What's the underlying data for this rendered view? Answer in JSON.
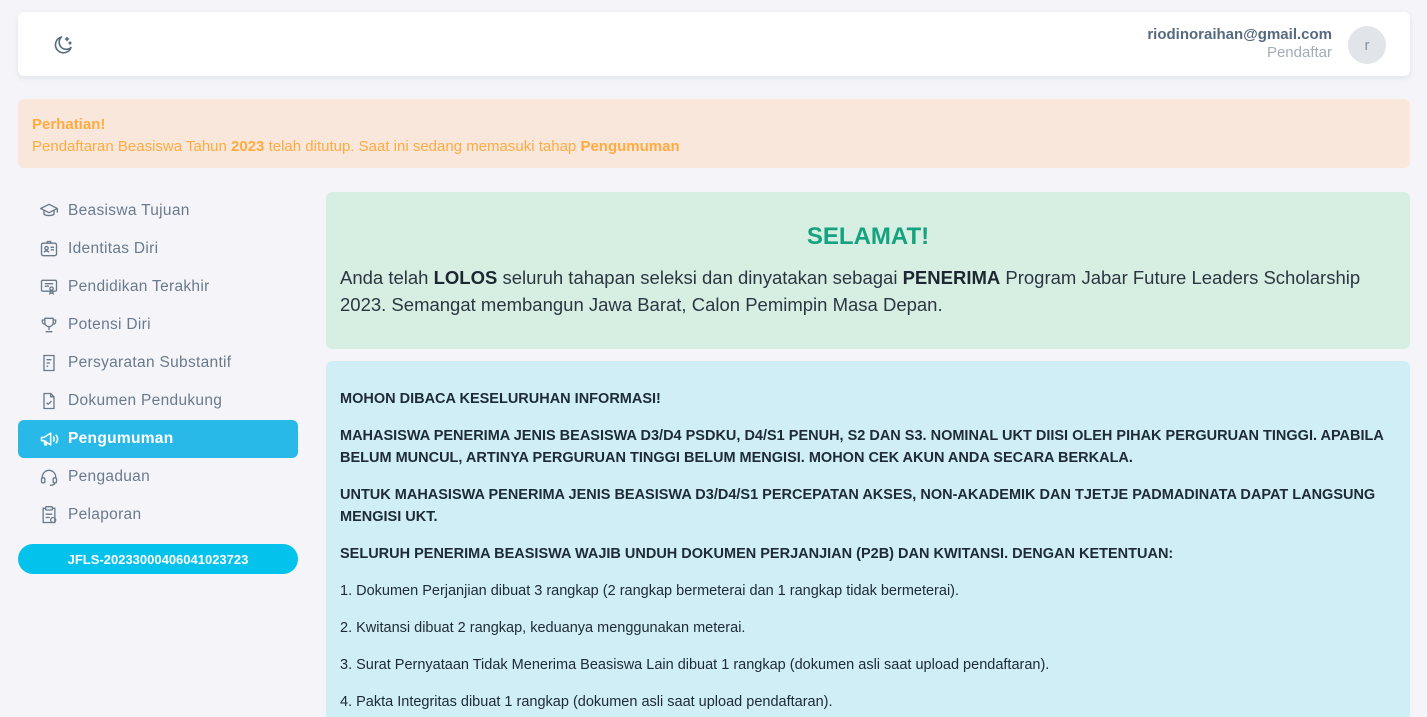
{
  "header": {
    "email": "riodinoraihan@gmail.com",
    "role": "Pendaftar",
    "avatar_initial": "r"
  },
  "alert": {
    "title": "Perhatian!",
    "text_before": "Pendaftaran Beasiswa Tahun ",
    "year": "2023",
    "text_middle": " telah ditutup. Saat ini sedang memasuki tahap ",
    "stage": "Pengumuman"
  },
  "sidebar": {
    "items": [
      {
        "label": "Beasiswa Tujuan",
        "icon": "graduation-cap-icon"
      },
      {
        "label": "Identitas Diri",
        "icon": "id-card-icon"
      },
      {
        "label": "Pendidikan Terakhir",
        "icon": "certificate-icon"
      },
      {
        "label": "Potensi Diri",
        "icon": "trophy-icon"
      },
      {
        "label": "Persyaratan Substantif",
        "icon": "clipboard-icon"
      },
      {
        "label": "Dokumen Pendukung",
        "icon": "file-check-icon"
      },
      {
        "label": "Pengumuman",
        "icon": "megaphone-icon"
      },
      {
        "label": "Pengaduan",
        "icon": "headset-icon"
      },
      {
        "label": "Pelaporan",
        "icon": "report-icon"
      }
    ],
    "active_index": 6,
    "registration_id": "JFLS-20233000406041023723"
  },
  "congrats": {
    "title": "SELAMAT!",
    "p1": "Anda telah ",
    "lolos": "LOLOS",
    "p2": " seluruh tahapan seleksi dan dinyatakan sebagai ",
    "penerima": "PENERIMA",
    "p3": " Program Jabar Future Leaders Scholarship 2023. Semangat membangun Jawa Barat, Calon Pemimpin Masa Depan."
  },
  "info": {
    "heading": "MOHON DIBACA KESELURUHAN INFORMASI!",
    "para1": "MAHASISWA PENERIMA JENIS BEASISWA D3/D4 PSDKU, D4/S1 PENUH, S2 DAN S3. NOMINAL UKT DIISI OLEH PIHAK PERGURUAN TINGGI. APABILA BELUM MUNCUL, ARTINYA PERGURUAN TINGGI BELUM MENGISI. MOHON CEK AKUN ANDA SECARA BERKALA.",
    "para2": "UNTUK MAHASISWA PENERIMA JENIS BEASISWA D3/D4/S1 PERCEPATAN AKSES, NON-AKADEMIK DAN TJETJE PADMADINATA DAPAT LANGSUNG MENGISI UKT.",
    "para3": "SELURUH PENERIMA BEASISWA WAJIB UNDUH DOKUMEN PERJANJIAN (P2B) DAN KWITANSI. DENGAN KETENTUAN:",
    "list": [
      "1. Dokumen Perjanjian dibuat 3 rangkap (2 rangkap bermeterai dan 1 rangkap tidak bermeterai).",
      "2. Kwitansi dibuat 2 rangkap, keduanya menggunakan meterai.",
      "3. Surat Pernyataan Tidak Menerima Beasiswa Lain dibuat 1 rangkap (dokumen asli saat upload pendaftaran).",
      "4. Pakta Integritas dibuat 1 rangkap (dokumen asli saat upload pendaftaran)."
    ]
  },
  "colors": {
    "accent": "#29b9e9",
    "badge": "#03c3ec",
    "success_text": "#15a37f",
    "warning_text": "#ffab40"
  }
}
